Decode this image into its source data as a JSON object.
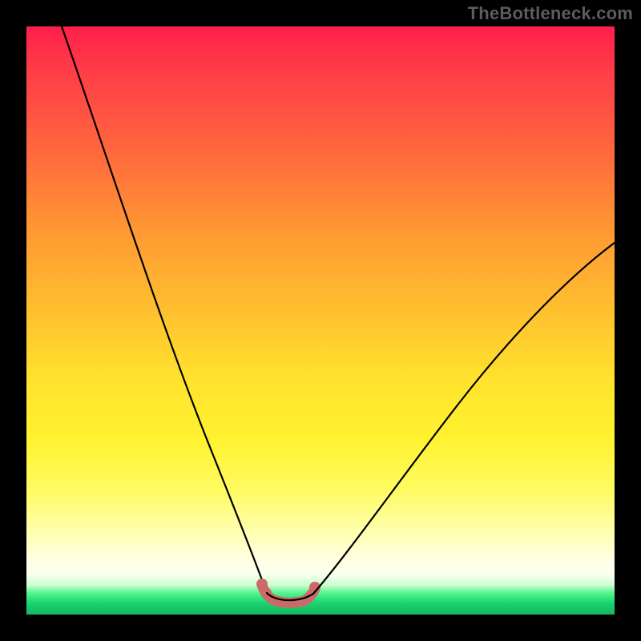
{
  "watermark": {
    "text": "TheBottleneck.com"
  },
  "colors": {
    "background": "#000000",
    "watermark_text": "#5c5c5c",
    "curve": "#000000",
    "trough_highlight": "#cc6a6a",
    "gradient_top": "#ff1f4a",
    "gradient_mid": "#ffe22e",
    "gradient_bottom": "#14b862"
  },
  "chart_data": {
    "type": "line",
    "title": "",
    "xlabel": "",
    "ylabel": "",
    "xlim": [
      0,
      100
    ],
    "ylim": [
      0,
      100
    ],
    "grid": false,
    "legend": false,
    "series": [
      {
        "name": "left-branch",
        "x": [
          6,
          10,
          14,
          18,
          22,
          26,
          30,
          33,
          35,
          37,
          38.5,
          40,
          41
        ],
        "y": [
          100,
          86,
          72,
          58.5,
          46,
          34.5,
          24,
          16.5,
          12,
          8.5,
          6.3,
          4.5,
          3.5
        ]
      },
      {
        "name": "trough",
        "x": [
          41,
          43,
          45,
          47,
          48.5
        ],
        "y": [
          3.5,
          2.6,
          2.3,
          2.5,
          3.2
        ]
      },
      {
        "name": "right-branch",
        "x": [
          48.5,
          52,
          56,
          62,
          70,
          80,
          90,
          100
        ],
        "y": [
          3.2,
          6.5,
          11.5,
          19,
          29.5,
          42,
          53,
          63
        ]
      }
    ],
    "highlight": {
      "name": "trough-highlight",
      "x_range": [
        40,
        49
      ],
      "y_range": [
        2.3,
        4.8
      ]
    },
    "background_gradient": {
      "direction": "vertical",
      "stops": [
        {
          "pos": 0.0,
          "color": "#ff1f4a"
        },
        {
          "pos": 0.35,
          "color": "#ff9933"
        },
        {
          "pos": 0.7,
          "color": "#fff22f"
        },
        {
          "pos": 0.93,
          "color": "#fdfff0"
        },
        {
          "pos": 0.97,
          "color": "#2be57a"
        },
        {
          "pos": 1.0,
          "color": "#14b862"
        }
      ]
    }
  }
}
